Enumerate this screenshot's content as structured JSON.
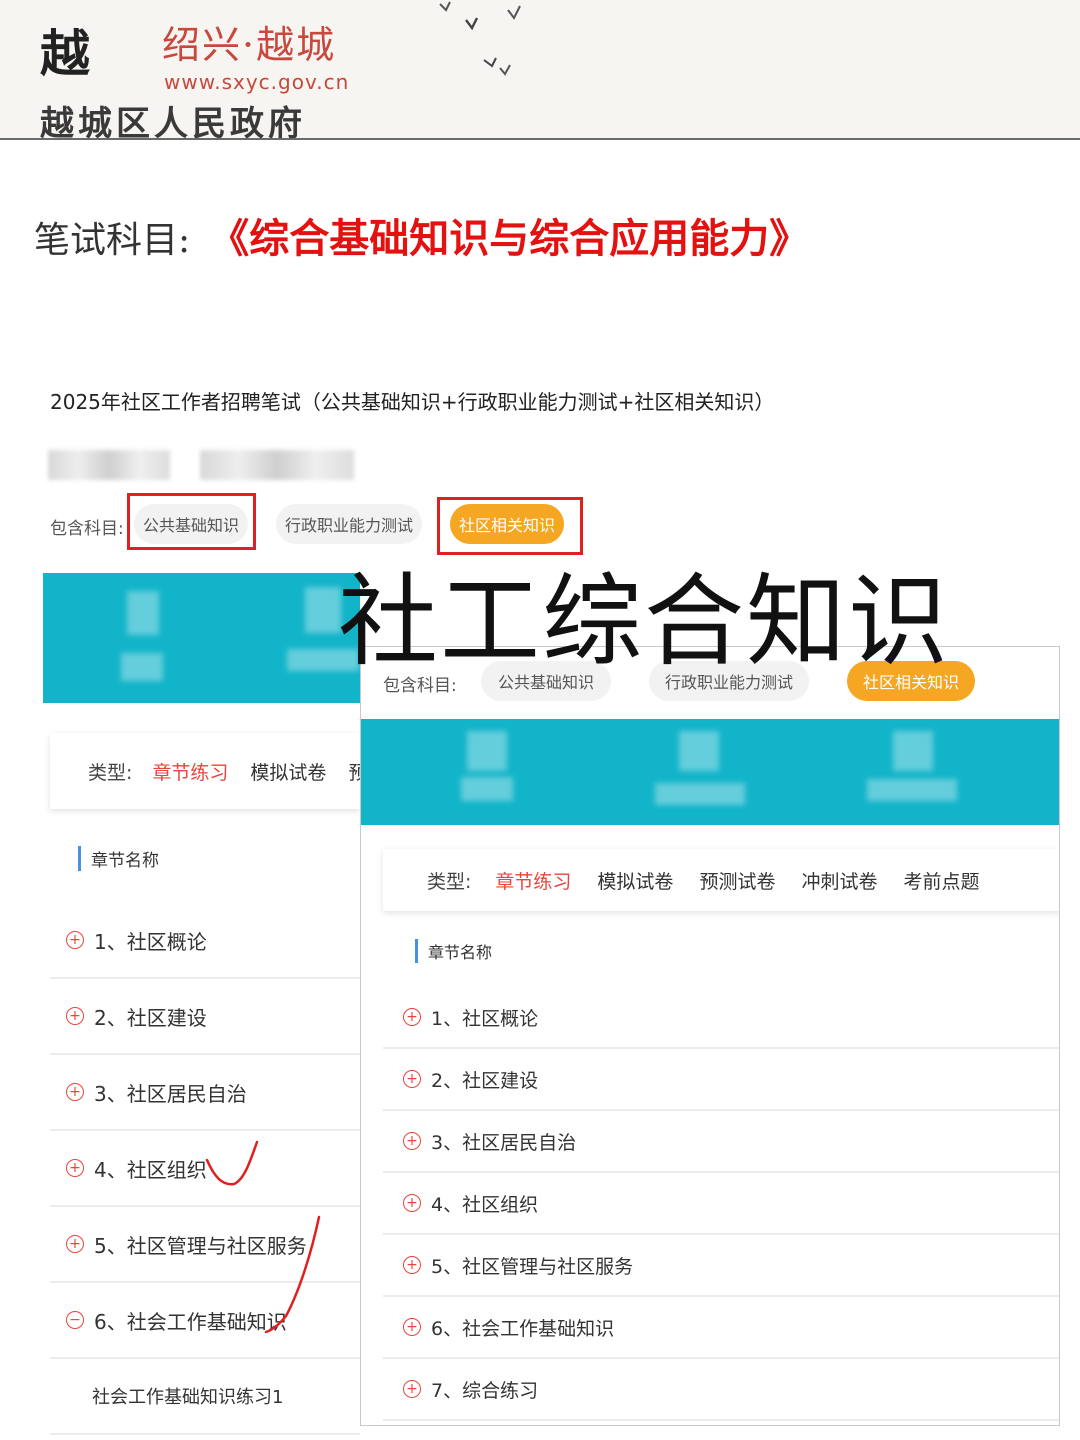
{
  "header": {
    "logo_mark": "越",
    "city_name": "绍兴·越城",
    "url": "www.sxyc.gov.cn",
    "government": "越城区人民政府"
  },
  "subject": {
    "label": "笔试科目:",
    "value": "《综合基础知识与综合应用能力》"
  },
  "course_title": "2025年社区工作者招聘笔试（公共基础知识+行政职业能力测试+社区相关知识）",
  "overlay_title": "社工综合知识",
  "subjects": {
    "label": "包含科目:",
    "items": [
      "公共基础知识",
      "行政职业能力测试",
      "社区相关知识"
    ],
    "active_index": 2
  },
  "types": {
    "label": "类型:",
    "items": [
      "章节练习",
      "模拟试卷",
      "预测试卷",
      "冲刺试卷",
      "考前点题"
    ],
    "active_index": 0,
    "back_truncated_third": "预测"
  },
  "chapter_header": "章节名称",
  "back_chapters": [
    {
      "icon": "plus-circle-icon",
      "label": "1、社区概论"
    },
    {
      "icon": "plus-circle-icon",
      "label": "2、社区建设"
    },
    {
      "icon": "plus-circle-icon",
      "label": "3、社区居民自治"
    },
    {
      "icon": "plus-circle-icon",
      "label": "4、社区组织"
    },
    {
      "icon": "plus-circle-icon",
      "label": "5、社区管理与社区服务"
    },
    {
      "icon": "minus-circle-icon",
      "label": "6、社会工作基础知识"
    }
  ],
  "back_sub_item": "社会工作基础知识练习1",
  "front_chapters": [
    {
      "icon": "plus-circle-icon",
      "label": "1、社区概论"
    },
    {
      "icon": "plus-circle-icon",
      "label": "2、社区建设"
    },
    {
      "icon": "plus-circle-icon",
      "label": "3、社区居民自治"
    },
    {
      "icon": "plus-circle-icon",
      "label": "4、社区组织"
    },
    {
      "icon": "plus-circle-icon",
      "label": "5、社区管理与社区服务"
    },
    {
      "icon": "plus-circle-icon",
      "label": "6、社会工作基础知识"
    },
    {
      "icon": "plus-circle-icon",
      "label": "7、综合练习"
    }
  ],
  "colors": {
    "accent_red": "#e8453c",
    "chip_active": "#f5a623",
    "band_teal": "#12b4c9",
    "annotation_red": "#e02020"
  }
}
